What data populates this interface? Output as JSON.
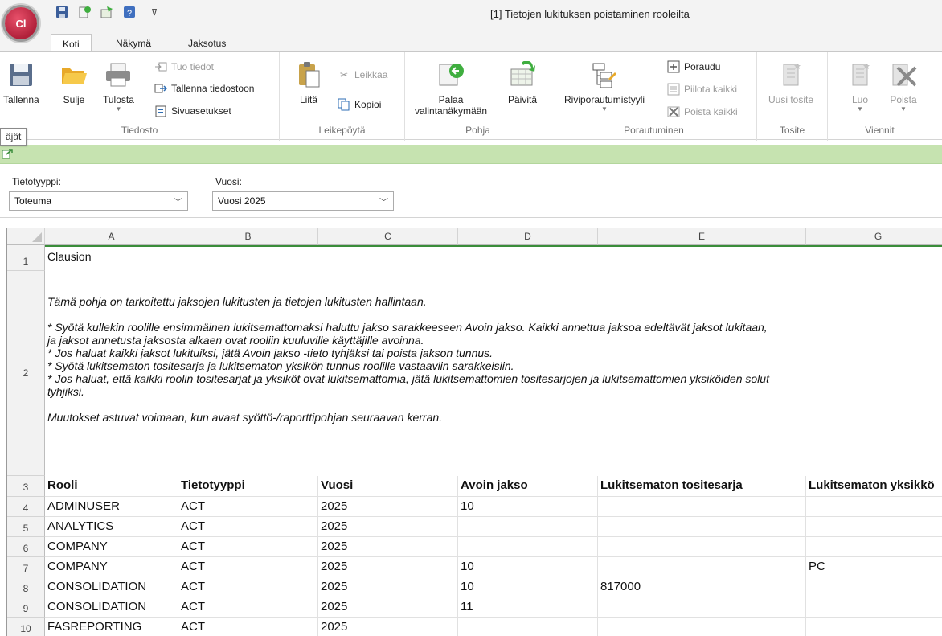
{
  "app": {
    "logo_text": "Cl",
    "window_title": "[1] Tietojen lukituksen poistaminen rooleilta"
  },
  "tabs": [
    {
      "label": "Koti",
      "active": true
    },
    {
      "label": "Näkymä",
      "active": false
    },
    {
      "label": "Jaksotus",
      "active": false
    }
  ],
  "ribbon": {
    "tiedosto": {
      "label": "Tiedosto",
      "save": "Tallenna",
      "close": "Sulje",
      "print": "Tulosta",
      "import": "Tuo tiedot",
      "save_to_file": "Tallenna tiedostoon",
      "page_setup": "Sivuasetukset"
    },
    "leikepoyta": {
      "label": "Leikepöytä",
      "paste": "Liitä",
      "cut": "Leikkaa",
      "copy": "Kopioi"
    },
    "pohja": {
      "label": "Pohja",
      "back_line1": "Palaa",
      "back_line2": "valintanäkymään",
      "refresh": "Päivitä"
    },
    "porautuminen": {
      "label": "Porautuminen",
      "style": "Riviporautumistyyli",
      "drill": "Poraudu",
      "hide_all": "Piilota kaikki",
      "remove_all": "Poista kaikki"
    },
    "tosite": {
      "label": "Tosite",
      "new": "Uusi tosite"
    },
    "viennit": {
      "label": "Viennit",
      "create": "Luo",
      "delete": "Poista"
    }
  },
  "tooltip": "äjät",
  "filters": {
    "type_label": "Tietotyyppi:",
    "type_value": "Toteuma",
    "year_label": "Vuosi:",
    "year_value": "Vuosi 2025"
  },
  "grid": {
    "columns": [
      "A",
      "B",
      "C",
      "D",
      "E",
      "G"
    ],
    "row_numbers": [
      "1",
      "2",
      "3",
      "4",
      "5",
      "6",
      "7",
      "8",
      "9",
      "10"
    ],
    "a1": "Clausion",
    "instructions": [
      "Tämä pohja on tarkoitettu jaksojen lukitusten ja tietojen lukitusten hallintaan.",
      "* Syötä kullekin roolille ensimmäinen lukitsemattomaksi haluttu jakso sarakkeeseen Avoin jakso. Kaikki annettua jaksoa edeltävät jaksot lukitaan,",
      "ja jaksot annetusta jaksosta alkaen ovat rooliin kuuluville käyttäjille avoinna.",
      "* Jos haluat kaikki jaksot lukituiksi, jätä Avoin jakso -tieto tyhjäksi tai poista jakson tunnus.",
      "* Syötä lukitsematon tositesarja ja lukitsematon yksikön tunnus roolille vastaaviin sarakkeisiin.",
      "* Jos haluat, että kaikki roolin tositesarjat ja yksiköt ovat lukitsemattomia, jätä lukitsemattomien tositesarjojen ja lukitsemattomien yksiköiden solut",
      "tyhjiksi.",
      "Muutokset astuvat voimaan, kun avaat syöttö-/raporttipohjan seuraavan kerran."
    ],
    "headers": [
      "Rooli",
      "Tietotyyppi",
      "Vuosi",
      "Avoin jakso",
      "Lukitsematon tositesarja",
      "Lukitsematon yksikkö"
    ],
    "rows": [
      [
        "ADMINUSER",
        "ACT",
        "2025",
        "10",
        "",
        ""
      ],
      [
        "ANALYTICS",
        "ACT",
        "2025",
        "",
        "",
        ""
      ],
      [
        "COMPANY",
        "ACT",
        "2025",
        "",
        "",
        ""
      ],
      [
        "COMPANY",
        "ACT",
        "2025",
        "10",
        "",
        "PC"
      ],
      [
        "CONSOLIDATION",
        "ACT",
        "2025",
        "10",
        "817000",
        ""
      ],
      [
        "CONSOLIDATION",
        "ACT",
        "2025",
        "11",
        "",
        ""
      ],
      [
        "FASREPORTING",
        "ACT",
        "2025",
        "",
        "",
        ""
      ]
    ]
  },
  "colors": {
    "accent_green": "#3a8d3a",
    "strip_green": "#c6e3b0",
    "logo_red": "#c0283f"
  }
}
